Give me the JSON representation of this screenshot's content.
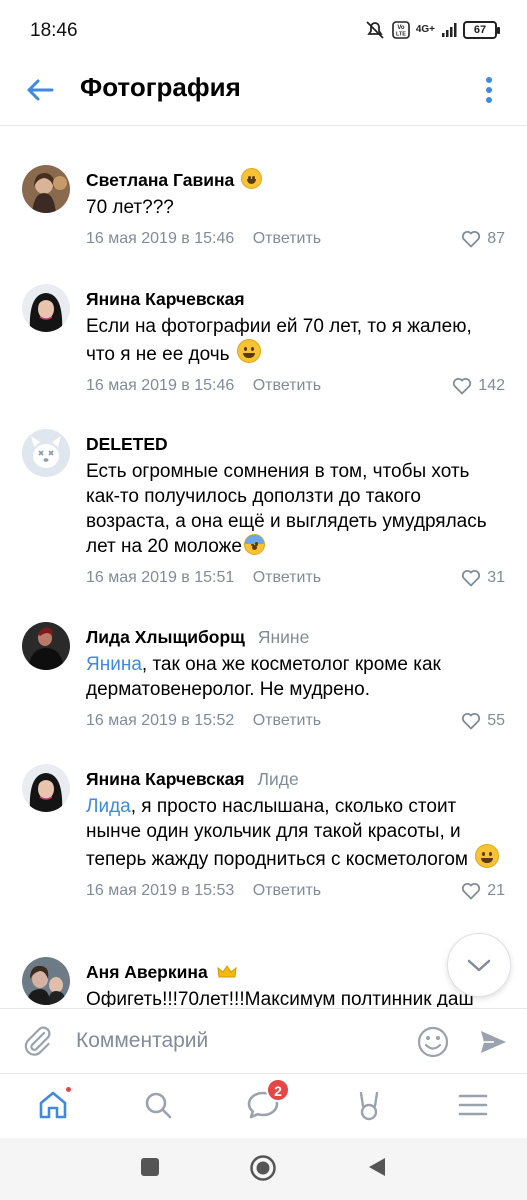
{
  "status_bar": {
    "time": "18:46",
    "network": "4G+",
    "battery": "67"
  },
  "header": {
    "title": "Фотография"
  },
  "comments": [
    {
      "author": "Светлана Гавина",
      "reply_to": "",
      "mention": "",
      "text": "70 лет???",
      "date": "16 мая 2019 в 15:46",
      "reply_label": "Ответить",
      "likes": "87",
      "name_emoji": "crazy-face"
    },
    {
      "author": "Янина Карчевская",
      "reply_to": "",
      "mention": "",
      "text": "Если на фотографии ей 70 лет, то я жалею, что я не ее дочь",
      "date": "16 мая 2019 в 15:46",
      "reply_label": "Ответить",
      "likes": "142",
      "text_emoji": "grinning-face"
    },
    {
      "author": "DELETED",
      "reply_to": "",
      "mention": "",
      "text": "Есть огромные сомнения в том, чтобы хоть как-то получилось доползти до такого возраста, а она ещё и выглядеть умудрялась лет на 20 моложе",
      "date": "16 мая 2019 в 15:51",
      "reply_label": "Ответить",
      "likes": "31",
      "text_emoji": "fearful-face"
    },
    {
      "author": "Лида Хлыщиборщ",
      "reply_to": "Янине",
      "mention": "Янина",
      "text": ", так она же косметолог кроме как дерматовенеролог. Не мудрено.",
      "date": "16 мая 2019 в 15:52",
      "reply_label": "Ответить",
      "likes": "55"
    },
    {
      "author": "Янина Карчевская",
      "reply_to": "Лиде",
      "mention": "Лида",
      "text": ", я просто наслышана, сколько стоит нынче один укольчик для такой красоты, и теперь жажду породниться с косметологом",
      "date": "16 мая 2019 в 15:53",
      "reply_label": "Ответить",
      "likes": "21",
      "text_emoji": "grinning-face"
    },
    {
      "author": "Аня Аверкина",
      "reply_to": "",
      "mention": "",
      "text": "Офигеть!!!70лет!!!Максимум полтинник даш",
      "name_emoji": "crown"
    }
  ],
  "composer": {
    "placeholder": "Комментарий"
  },
  "bottom_nav": {
    "items": [
      "home",
      "search",
      "messages",
      "clips",
      "menu"
    ],
    "messages_badge": "2"
  },
  "colors": {
    "accent": "#3f8ae0",
    "secondary_text": "#818c99",
    "badge": "#e64646"
  }
}
